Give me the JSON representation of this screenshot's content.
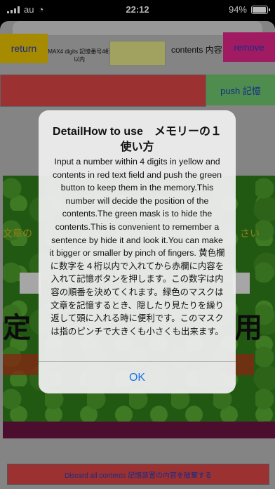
{
  "status_bar": {
    "carrier": "au",
    "time": "22:12",
    "battery": "94%"
  },
  "toolbar": {
    "return_label": "return",
    "max_label": "MAX4 digits 記憶番号4桁以内",
    "contents_label": "contents 内容",
    "remove_label": "remove"
  },
  "push_label": "push 記憶",
  "mask": {
    "left_text": "文章の",
    "right_text": "さい",
    "big_left": "定",
    "big_right": "用"
  },
  "discard_label": "Discard all contents 記憶装置の内容を破棄する",
  "alert": {
    "title": "DetailHow to use　メモリーの１　使い方",
    "body": "Input a number within 4 digits in yellow and contents in red text field and push the green button to keep them in the memory.This number will decide the position of the contents.The green mask is to hide the contents.This is convenient to remember a sentence by hide it and look it.You can make it bigger or smaller by pinch of fingers. 黄色欄に数字を４桁以内で入れてから赤欄に内容を入れて記憶ボタンを押します。この数字は内容の順番を決めてくれます。緑色のマスクは文章を記憶するとき、隠したり見たりを繰り返して頭に入れる時に便利です。このマスクは指のピンチで大きくも小さくも出来ます。",
    "ok_label": "OK"
  }
}
